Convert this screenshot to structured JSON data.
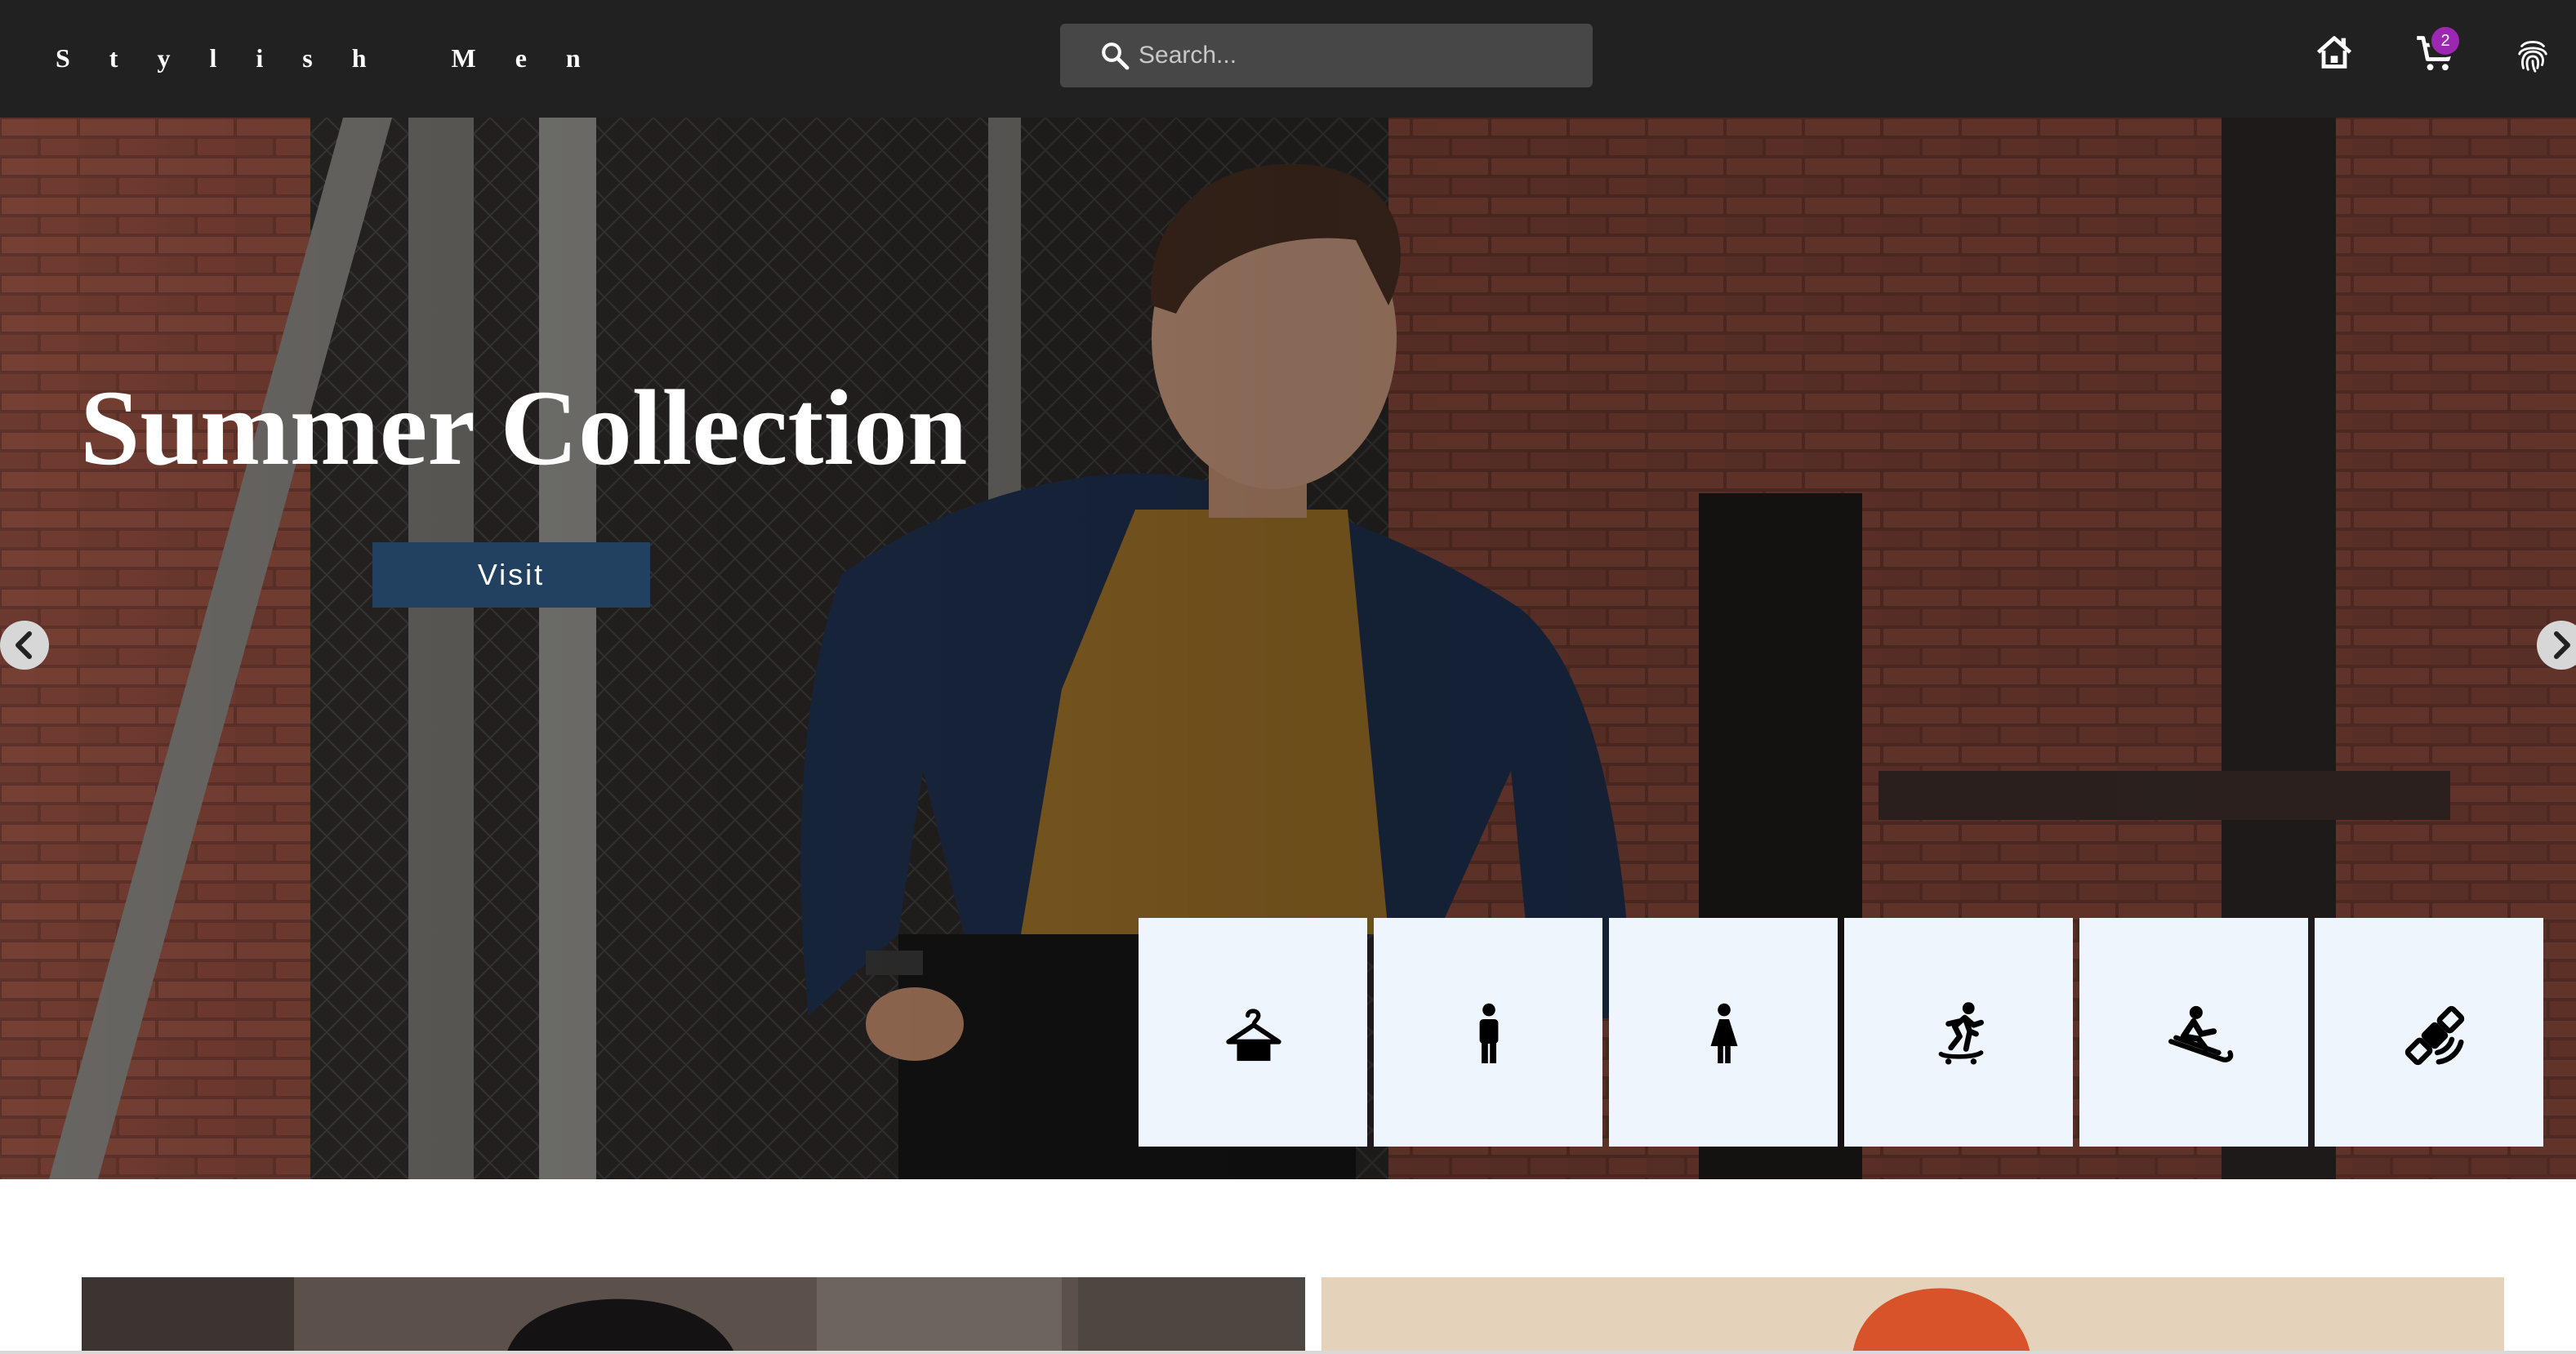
{
  "brand": {
    "name": "S t y l i s h   M e n"
  },
  "search": {
    "placeholder": "Search..."
  },
  "nav": {
    "icons": [
      "home-icon",
      "shopping-cart-icon",
      "fingerprint-icon"
    ],
    "cart_count": "2",
    "badge_color": "#9c27b0"
  },
  "hero": {
    "title": "Summer Collection",
    "button_label": "Visit",
    "button_color": "#22405f",
    "arrows": [
      "chevron-left-icon",
      "chevron-right-icon"
    ]
  },
  "categories": [
    {
      "icon": "hanger-icon"
    },
    {
      "icon": "man-icon"
    },
    {
      "icon": "woman-icon"
    },
    {
      "icon": "skateboarding-icon"
    },
    {
      "icon": "sledding-icon"
    },
    {
      "icon": "satellite-icon"
    }
  ],
  "promos": [
    {
      "image": "man-portrait-photo"
    },
    {
      "image": "orange-beanie-photo"
    }
  ]
}
